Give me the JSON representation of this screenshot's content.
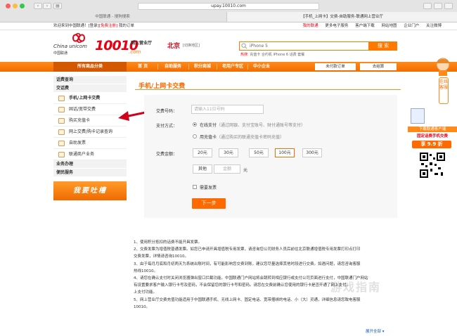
{
  "browser": {
    "url": "upay.10010.com",
    "tabs": [
      "中国联通 - 搜狗搜索",
      "【手机_上网卡】交费-自助服务-联通网上营业厅"
    ]
  },
  "topbar": {
    "welcome": "欢迎来到中国联通！",
    "login": "[登录]",
    "register": "[免费注册]",
    "my_orders": "我的订单",
    "links": [
      "我的联通",
      "更多电子服务",
      "客户端下载",
      "网站地图",
      "企业门户",
      "关注微博"
    ]
  },
  "header": {
    "logo_en": "China unicom",
    "logo_cn": "中国联通",
    "logo_number": "10010",
    "logo_com": ".com",
    "logo_hall": "网上营业厅",
    "city": "北京",
    "city_switch": "[切换地区]",
    "search_placeholder": "iPhone 5",
    "search_button": "搜 索",
    "hot_label": "热搜:",
    "hot_words": "充值卡  合约机  iPhone 6  话费  套餐"
  },
  "nav": {
    "category": "所有商品分类",
    "items": [
      "首  页",
      "自助服务",
      "积分商城",
      "老用户专区",
      "中小企业"
    ],
    "login_label": "未付款订单",
    "cart_label": "去结算"
  },
  "sidebar": {
    "groups": [
      {
        "label": "话费查询"
      },
      {
        "label": "交话费"
      }
    ],
    "items": [
      {
        "label": "手机/上网卡交费",
        "active": true
      },
      {
        "label": "固话/宽带交费",
        "active": false
      },
      {
        "label": "购买充值卡",
        "active": false
      },
      {
        "label": "网上交费/购卡记录查询",
        "active": false
      },
      {
        "label": "自助发票",
        "active": false
      },
      {
        "label": "联通商户业务",
        "active": false
      }
    ],
    "groups2": [
      {
        "label": "业务办理"
      },
      {
        "label": "便民服务"
      }
    ],
    "complain": "我要吐槽"
  },
  "main": {
    "title": "手机/上网卡交费",
    "number_label": "交费号码：",
    "number_placeholder": "请输入11位号码",
    "pay_label": "支付方式：",
    "pay_online": "在线支付",
    "pay_online_note": "（通过网银、支付宝账号、财付通账号等支付）",
    "pay_card": "用充值卡",
    "pay_card_note": "（通过购买的联通充值卡密码充值）",
    "amount_label": "交费金额：",
    "amounts": [
      "20元",
      "30元",
      "50元",
      "100元",
      "300元"
    ],
    "selected_amount": "100元",
    "other": "其他",
    "amount_placeholder": "金额",
    "yuan": "元",
    "invoice": "需要发票",
    "next": "下一步"
  },
  "notes": [
    "1、使用积分抵扣的话费不能开具发票。",
    "2、交费发票为增值税普通发票。如您已申请开具增值税专用发票，请咨询您公司财务人员后前往北京联通增值税专用发票打印点打印",
    "交费发票，详情请咨询10010。",
    "3、由于每月月底和月初两天为系统出账时间，有可能影响您交费到账，建议您尽量选择其他时段进行交费。如遇问题，请您咨询客服",
    "热线10010。",
    "4、请您在确认支付时关闭浏览器弹出窗口拦截功能。中国联通门户网站将会跳转到相应银行或支付公司页面进行支付，中国联通门户网站",
    "有设置要求客户输入银行卡号及密码，不会保留您的银行卡号和密码。请您在交费前确认您使用的银行卡是否开通了网上支付。",
    "上支付功能。",
    "5、网上营业厅交费充值功能适用于中国联通手机、无线上网卡、固定电话、宽带捆绑的电话、小（大）灵通，详细信息请您致电客服",
    "10010。"
  ],
  "expand": "展开全部",
  "right_ad": {
    "service": "在线客服",
    "promo1": "下载联通客户端",
    "promo2": "固定话费手机交费",
    "discount": "享 9.9 折"
  },
  "watermark": "游戏指南",
  "colors": {
    "brand_orange": "#ff6a00",
    "brand_red": "#e60012"
  }
}
